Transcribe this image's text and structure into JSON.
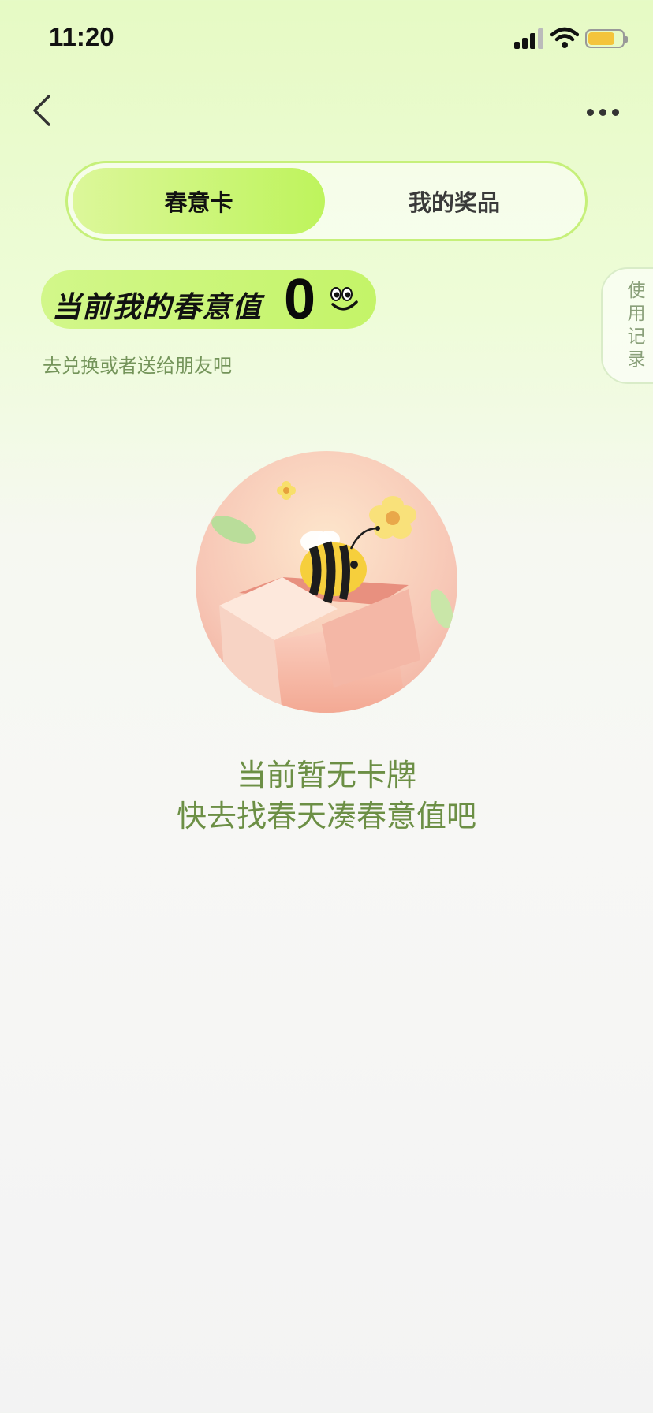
{
  "status_bar": {
    "time": "11:20",
    "icons": [
      "cellular-signal-icon",
      "wifi-icon",
      "battery-icon"
    ],
    "battery_level": 0.78
  },
  "nav": {
    "back_icon": "chevron-left-icon",
    "more_icon": "more-horizontal-icon"
  },
  "tabs": [
    {
      "label": "春意卡",
      "active": true
    },
    {
      "label": "我的奖品",
      "active": false
    }
  ],
  "value_banner": {
    "label": "当前我的春意值",
    "value": "0",
    "icon": "smile-face-icon"
  },
  "subtitle": "去兑换或者送给朋友吧",
  "side_tab": {
    "chars": [
      "使",
      "用",
      "记",
      "录"
    ]
  },
  "illustration": {
    "icon": "bee-on-gift-box-illustration"
  },
  "empty_state": {
    "line1": "当前暂无卡牌",
    "line2": "快去找春天凑春意值吧"
  },
  "colors": {
    "accent_green": "#c4f468",
    "text_green": "#6c8f45",
    "subtitle_green": "#74945a",
    "battery_yellow": "#f4c43c"
  }
}
